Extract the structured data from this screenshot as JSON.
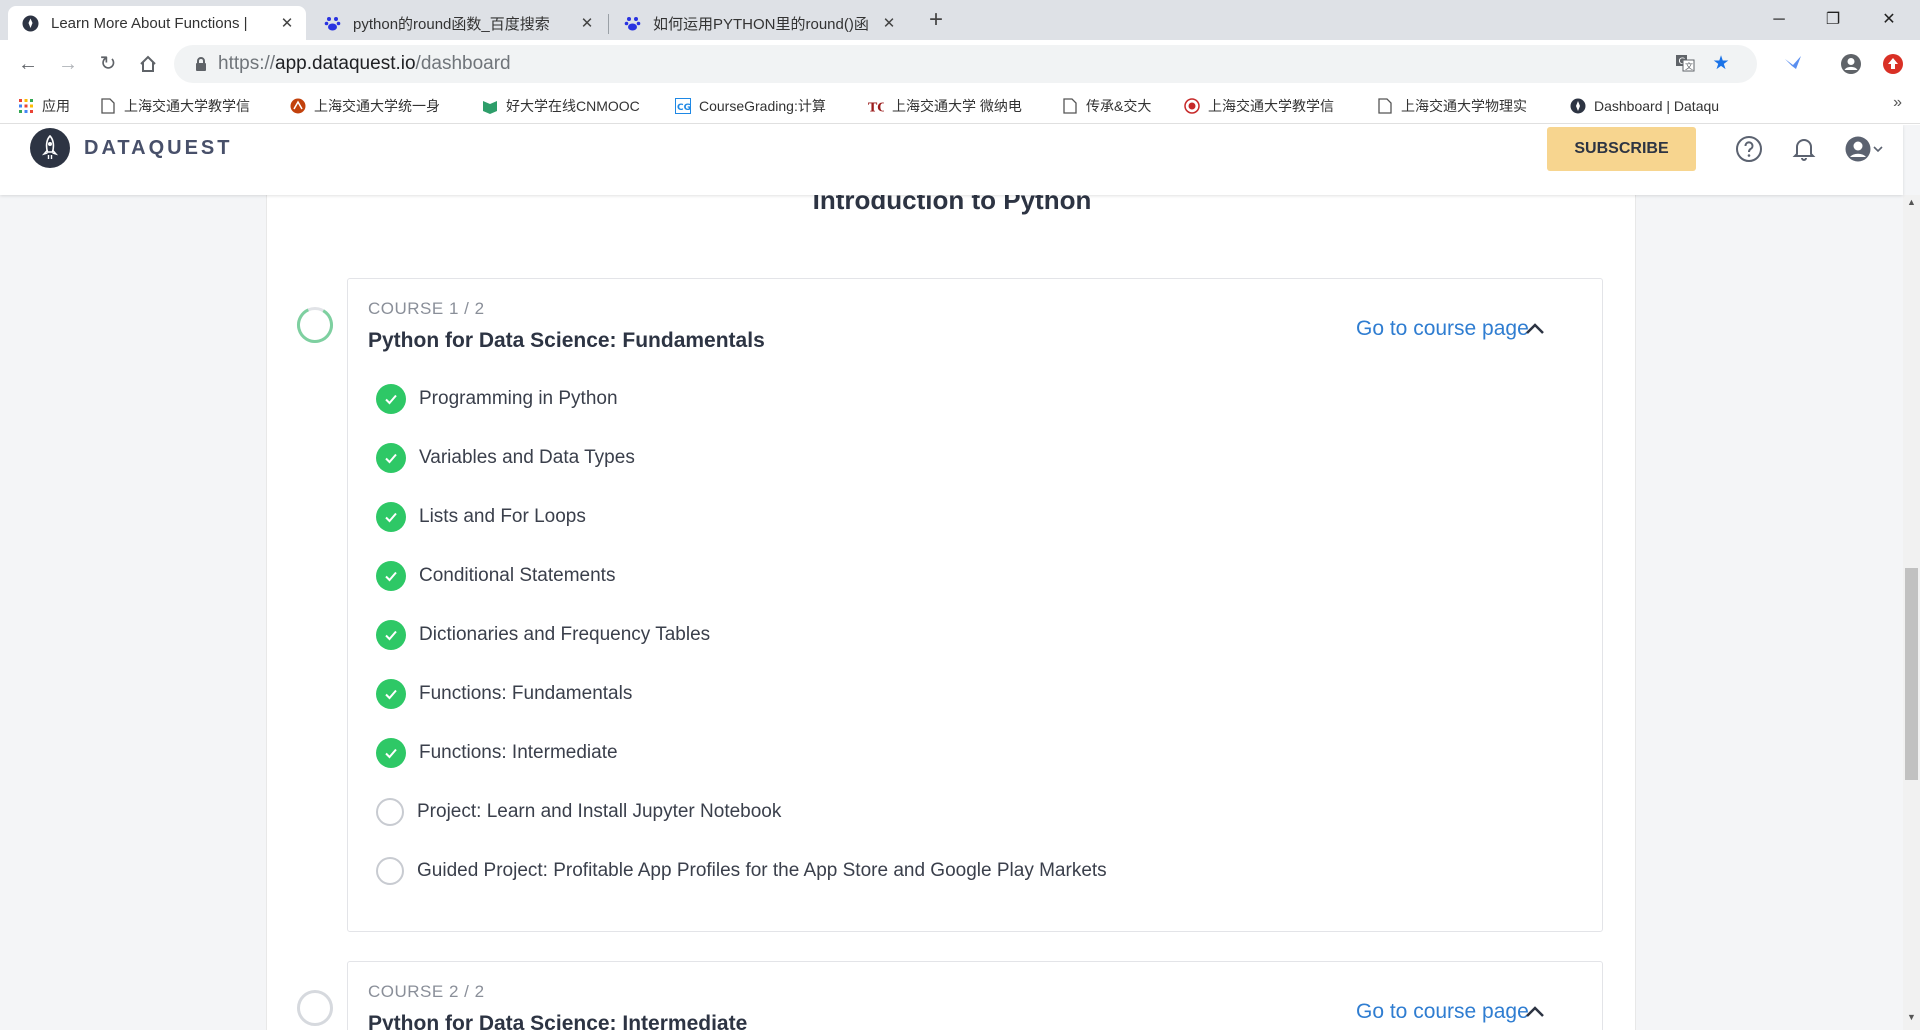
{
  "browser": {
    "tabs": [
      {
        "title": "Learn More About Functions |",
        "favicon": "dataquest-favicon",
        "active": true
      },
      {
        "title": "python的round函数_百度搜索",
        "favicon": "baidu-paw-icon",
        "active": false
      },
      {
        "title": "如何运用PYTHON里的round()函",
        "favicon": "baidu-paw-icon",
        "active": false
      }
    ],
    "new_tab": "+",
    "window_controls": {
      "minimize": "─",
      "maximize": "❐",
      "close": "✕"
    },
    "url": {
      "scheme": "https://",
      "host": "app.dataquest.io",
      "path": "/dashboard"
    },
    "bookmarks": [
      {
        "label": "应用",
        "icon": "apps-grid-icon"
      },
      {
        "label": "上海交通大学教学信",
        "icon": "page-icon"
      },
      {
        "label": "上海交通大学统一身",
        "icon": "sjtu-icon"
      },
      {
        "label": "好大学在线CNMOOC",
        "icon": "cnmooc-icon"
      },
      {
        "label": "CourseGrading:计算",
        "icon": "coursegrading-icon"
      },
      {
        "label": "上海交通大学 微纳电",
        "icon": "tc-icon"
      },
      {
        "label": "传承&交大",
        "icon": "page-icon"
      },
      {
        "label": "上海交通大学教学信",
        "icon": "sjtu-seal-icon"
      },
      {
        "label": "上海交通大学物理实",
        "icon": "page-icon"
      },
      {
        "label": "Dashboard | Dataqu",
        "icon": "dataquest-favicon"
      }
    ],
    "bookmarks_more": "»"
  },
  "header": {
    "logo_text": "DATAQUEST",
    "subscribe_label": "SUBSCRIBE"
  },
  "path": {
    "section_title": "Introduction to Python"
  },
  "courses": [
    {
      "number": "COURSE 1 / 2",
      "name": "Python for Data Science: Fundamentals",
      "link": "Go to course page",
      "lessons": [
        {
          "name": "Programming in Python",
          "done": true
        },
        {
          "name": "Variables and Data Types",
          "done": true
        },
        {
          "name": "Lists and For Loops",
          "done": true
        },
        {
          "name": "Conditional Statements",
          "done": true
        },
        {
          "name": "Dictionaries and Frequency Tables",
          "done": true
        },
        {
          "name": "Functions: Fundamentals",
          "done": true
        },
        {
          "name": "Functions: Intermediate",
          "done": true
        },
        {
          "name": "Project: Learn and Install Jupyter Notebook",
          "done": false
        },
        {
          "name": "Guided Project: Profitable App Profiles for the App Store and Google Play Markets",
          "done": false
        }
      ]
    },
    {
      "number": "COURSE 2 / 2",
      "name": "Python for Data Science: Intermediate",
      "link": "Go to course page",
      "lessons": []
    }
  ],
  "colors": {
    "check_green": "#2ec866",
    "link_blue": "#2f7dd1",
    "subscribe_yellow": "#f7d58f",
    "ring_green": "#7ed0a0"
  }
}
